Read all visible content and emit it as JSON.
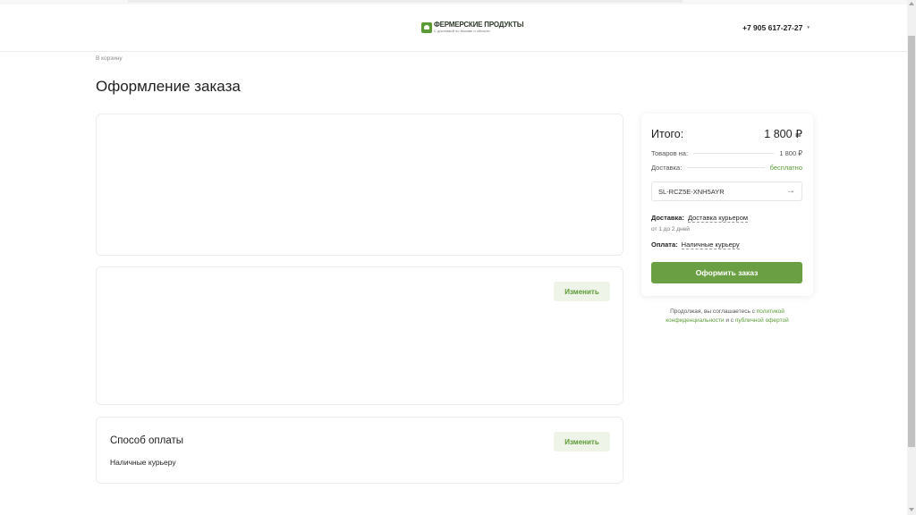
{
  "header": {
    "logo_title": "ФЕРМЕРСКИЕ ПРОДУКТЫ",
    "logo_subtitle": "С доставкой по Москве и области",
    "phone": "+7 905 617-27-27",
    "phone_chevron": "▾"
  },
  "page": {
    "back_link": "В корзину",
    "title": "Оформление заказа"
  },
  "sections": {
    "delivery": {
      "change_label": "Изменить"
    },
    "payment": {
      "title": "Способ оплаты",
      "value": "Наличные курьеру",
      "change_label": "Изменить"
    }
  },
  "summary": {
    "total_label": "Итого:",
    "total_value": "1 800 ₽",
    "goods_label": "Товаров на:",
    "goods_value": "1 800 ₽",
    "delivery_label": "Доставка:",
    "delivery_value": "бесплатно",
    "promo_code": "SL-RCZ5E-XNH5AYR",
    "promo_arrow": "→",
    "delivery_method_label": "Доставка:",
    "delivery_method_value": "Доставка курьером",
    "delivery_time": "от 1 до 2 дней",
    "payment_method_label": "Оплата:",
    "payment_method_value": "Наличные курьеру",
    "order_button": "Оформить заказ"
  },
  "agreement": {
    "prefix": "Продолжая, вы соглашаетесь с ",
    "privacy_link": "политикой конфиденциальности",
    "middle": " и с ",
    "offer_link": "публичной офертой"
  },
  "colors": {
    "brand_green": "#6b9f43",
    "accent_green": "#5b9b37",
    "button_light_bg": "#eef5e8"
  }
}
